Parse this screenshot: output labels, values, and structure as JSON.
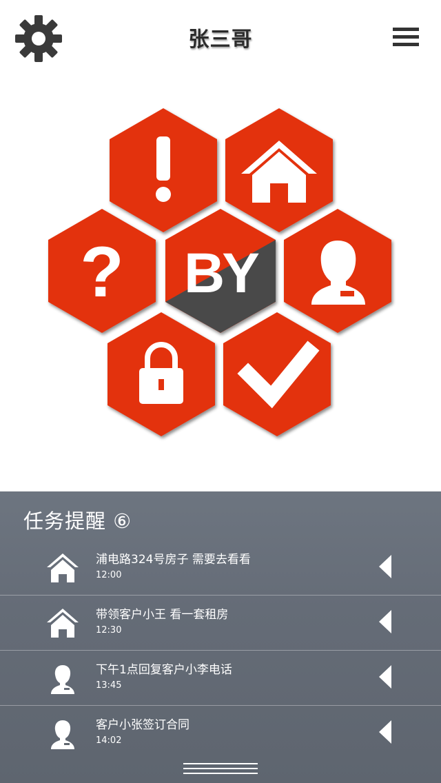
{
  "header": {
    "title": "张三哥",
    "left_icon": "gear-icon",
    "right_icon": "hamburger-menu-icon"
  },
  "hive": {
    "center_text": "BY",
    "tiles": [
      "alert-icon",
      "home-icon",
      "question-icon",
      "user-icon",
      "lock-icon",
      "check-icon"
    ],
    "accent": "#e3320f",
    "center_color": "#4a4a4a"
  },
  "tasks": {
    "title": "任务提醒",
    "badge": "⑥",
    "items": [
      {
        "icon": "home-icon",
        "text": "浦电路324号房子 需要去看看",
        "time": "12:00"
      },
      {
        "icon": "home-icon",
        "text": "带领客户小王 看一套租房",
        "time": "12:30"
      },
      {
        "icon": "user-icon",
        "text": "下午1点回复客户小李电话",
        "time": "13:45"
      },
      {
        "icon": "user-icon",
        "text": "客户小张签订合同",
        "time": "14:02"
      }
    ]
  }
}
